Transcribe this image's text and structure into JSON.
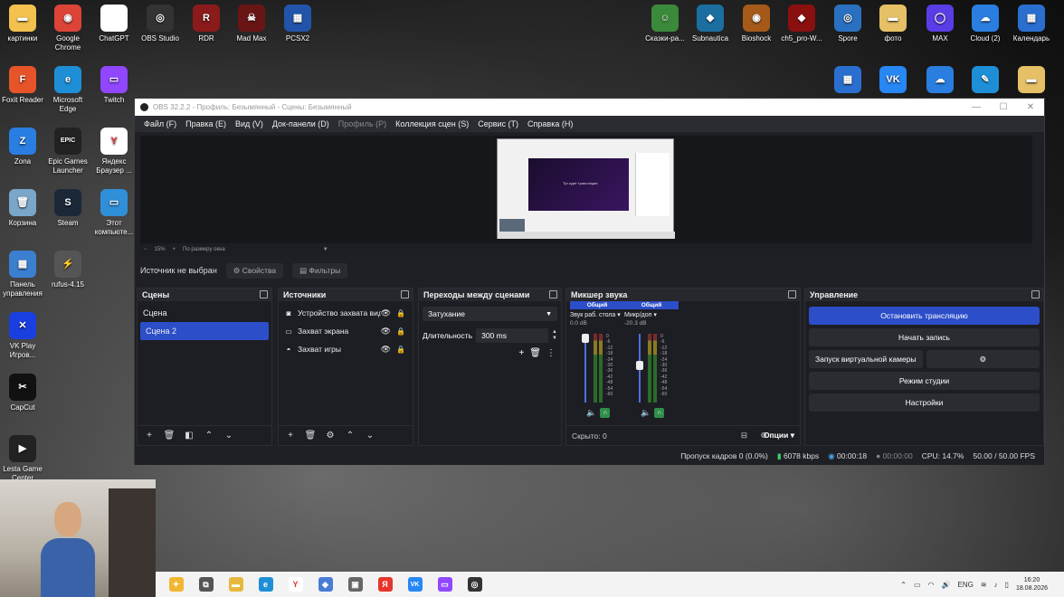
{
  "desktop": {
    "left_icons": [
      {
        "label": "картинки",
        "color": "#f2c14e",
        "glyph": "▬",
        "icon": "folder-icon"
      },
      {
        "label": "Foxit Reader",
        "color": "#e8542a",
        "glyph": "F",
        "icon": "foxit-icon"
      },
      {
        "label": "Zona",
        "color": "#2a7de1",
        "glyph": "Z",
        "icon": "zona-icon"
      },
      {
        "label": "Корзина",
        "color": "#7aa6c9",
        "glyph": "🗑",
        "icon": "recycle-bin-icon"
      },
      {
        "label": "Панель управления",
        "color": "#3b7fd0",
        "glyph": "▦",
        "icon": "control-panel-icon"
      },
      {
        "label": "VK Play Игров...",
        "color": "#1a3fe0",
        "glyph": "✕",
        "icon": "vk-play-icon"
      },
      {
        "label": "CapCut",
        "color": "#111111",
        "glyph": "✂",
        "icon": "capcut-icon"
      },
      {
        "label": "Lesta Game Center",
        "color": "#222222",
        "glyph": "▶",
        "icon": "lesta-icon"
      }
    ],
    "col2_icons": [
      {
        "label": "Google Chrome",
        "color": "#db4437",
        "glyph": "◉",
        "icon": "chrome-icon"
      },
      {
        "label": "Microsoft Edge",
        "color": "#1e8fd6",
        "glyph": "e",
        "icon": "edge-icon"
      },
      {
        "label": "Epic Games Launcher",
        "color": "#222222",
        "glyph": "EPIC",
        "icon": "epic-icon"
      },
      {
        "label": "Steam",
        "color": "#1b2838",
        "glyph": "S",
        "icon": "steam-icon"
      },
      {
        "label": "rufus-4.15",
        "color": "#555555",
        "glyph": "⚡",
        "icon": "rufus-icon"
      }
    ],
    "col3_icons": [
      {
        "label": "ChatGPT",
        "color": "#ffffff",
        "glyph": "",
        "icon": "file-icon"
      },
      {
        "label": "Twitch",
        "color": "#9146ff",
        "glyph": "▭",
        "icon": "twitch-icon"
      },
      {
        "label": "Яндекс Браузер ...",
        "color": "#ffffff",
        "glyph": "Y",
        "icon": "yandex-browser-icon"
      },
      {
        "label": "Этот компьюте...",
        "color": "#2f8fd8",
        "glyph": "▭",
        "icon": "computer-icon"
      }
    ],
    "top_row": [
      {
        "label": "OBS Studio",
        "color": "#333333",
        "glyph": "◎",
        "icon": "obs-icon"
      },
      {
        "label": "RDR",
        "color": "#8b1a1a",
        "glyph": "R",
        "icon": "rdr-icon"
      },
      {
        "label": "Mad Max",
        "color": "#6a1515",
        "glyph": "☠",
        "icon": "madmax-icon"
      },
      {
        "label": "PCSX2",
        "color": "#2255aa",
        "glyph": "▦",
        "icon": "pcsx2-icon"
      }
    ],
    "right_row": [
      {
        "label": "Сказки-ра...",
        "color": "#3b8a3b",
        "glyph": "☺",
        "icon": "game-icon"
      },
      {
        "label": "Subnautica",
        "color": "#1b6fa0",
        "glyph": "◆",
        "icon": "subnautica-icon"
      },
      {
        "label": "Bioshock",
        "color": "#a55a1a",
        "glyph": "◉",
        "icon": "bioshock-icon"
      },
      {
        "label": "ch5_pro-W...",
        "color": "#8a1010",
        "glyph": "◆",
        "icon": "game-icon"
      },
      {
        "label": "Spore",
        "color": "#2a70c0",
        "glyph": "◎",
        "icon": "spore-icon"
      },
      {
        "label": "фото",
        "color": "#e6c066",
        "glyph": "▬",
        "icon": "folder-icon"
      },
      {
        "label": "MAX",
        "color": "#5a3de6",
        "glyph": "◯",
        "icon": "max-icon"
      },
      {
        "label": "Cloud (2)",
        "color": "#2a7ee0",
        "glyph": "☁",
        "icon": "cloud-icon"
      },
      {
        "label": "Календарь",
        "color": "#2a6fd0",
        "glyph": "▦",
        "icon": "calendar-icon"
      }
    ],
    "right_row2": [
      {
        "label": "",
        "color": "#2a6fd0",
        "glyph": "▦",
        "icon": "calculator-icon"
      },
      {
        "label": "",
        "color": "#2787f5",
        "glyph": "VK",
        "icon": "vk-icon"
      },
      {
        "label": "",
        "color": "#2a7ee0",
        "glyph": "☁",
        "icon": "cloud-icon"
      },
      {
        "label": "",
        "color": "#1e8fd6",
        "glyph": "✎",
        "icon": "app-icon"
      },
      {
        "label": "",
        "color": "#e6c066",
        "glyph": "▬",
        "icon": "folder-icon"
      }
    ]
  },
  "obs": {
    "title": "OBS 32.2.2 - Профиль: Безымянный - Сцены: Безымянный",
    "menu": [
      {
        "label": "Файл (F)",
        "enabled": true
      },
      {
        "label": "Правка (E)",
        "enabled": true
      },
      {
        "label": "Вид (V)",
        "enabled": true
      },
      {
        "label": "Док-панели (D)",
        "enabled": true
      },
      {
        "label": "Профиль (P)",
        "enabled": false
      },
      {
        "label": "Коллекция сцен (S)",
        "enabled": true
      },
      {
        "label": "Сервис (T)",
        "enabled": true
      },
      {
        "label": "Справка (H)",
        "enabled": true
      }
    ],
    "preview": {
      "inner_text": "Тут идет трансляция",
      "zoom_minus": "−",
      "zoom_value": "15%",
      "zoom_plus": "+",
      "zoom_mode": "По размеру окна"
    },
    "source_bar": {
      "status": "Источник не выбран",
      "properties": "Свойства",
      "filters": "Фильтры"
    },
    "scenes": {
      "title": "Сцены",
      "items": [
        {
          "label": "Сцена",
          "selected": false
        },
        {
          "label": "Сцена 2",
          "selected": true
        }
      ]
    },
    "sources": {
      "title": "Источники",
      "items": [
        {
          "label": "Устройство захвата видео",
          "icon": "camera-icon",
          "glyph": "◙"
        },
        {
          "label": "Захват экрана",
          "icon": "monitor-icon",
          "glyph": "▭"
        },
        {
          "label": "Захват игры",
          "icon": "gamepad-icon",
          "glyph": "◓"
        }
      ]
    },
    "transitions": {
      "title": "Переходы между сценами",
      "selected": "Затухание",
      "duration_label": "Длительность",
      "duration_value": "300 ms"
    },
    "mixer": {
      "title": "Микшер звука",
      "channels": [
        {
          "tag": "Общий",
          "name": "Звук раб. стола",
          "db": "0.0 dB",
          "level": 1.0
        },
        {
          "tag": "Общий",
          "name": "Микр/доп",
          "db": "-20.3 dB",
          "level": 0.55
        }
      ],
      "scale": [
        "0",
        "-6",
        "-12",
        "-18",
        "-24",
        "-30",
        "-36",
        "-42",
        "-48",
        "-54",
        "-60"
      ],
      "hidden": "Скрыто: 0",
      "options": "Опции"
    },
    "controls": {
      "title": "Управление",
      "stop_stream": "Остановить трансляцию",
      "start_record": "Начать запись",
      "virtual_cam": "Запуск виртуальной камеры",
      "studio_mode": "Режим студии",
      "settings": "Настройки"
    },
    "status": {
      "dropped": "Пропуск кадров 0 (0.0%)",
      "bitrate": "6078 kbps",
      "stream_time": "00:00:18",
      "record_time": "00:00:00",
      "cpu": "CPU: 14.7%",
      "fps": "50.00 / 50.00 FPS"
    }
  },
  "taskbar": {
    "items": [
      {
        "icon": "copilot-icon",
        "color": "#f2b632",
        "glyph": "✦"
      },
      {
        "icon": "task-view-icon",
        "color": "#555555",
        "glyph": "⧉"
      },
      {
        "icon": "explorer-icon",
        "color": "#e6b93e",
        "glyph": "▬"
      },
      {
        "icon": "edge-icon",
        "color": "#1e8fd6",
        "glyph": "e"
      },
      {
        "icon": "yandex-browser-icon",
        "color": "#ffffff",
        "glyph": "Y"
      },
      {
        "icon": "store-icon",
        "color": "#4a7bd6",
        "glyph": "◆"
      },
      {
        "icon": "app-icon",
        "color": "#666666",
        "glyph": "▣"
      },
      {
        "icon": "yandex-icon",
        "color": "#e8342a",
        "glyph": "Я"
      },
      {
        "icon": "vk-icon",
        "color": "#2787f5",
        "glyph": "VK"
      },
      {
        "icon": "twitch-icon",
        "color": "#9146ff",
        "glyph": "▭"
      },
      {
        "icon": "obs-icon",
        "color": "#333333",
        "glyph": "◎"
      }
    ],
    "lang": "ENG",
    "time": "16:20",
    "date": "18.08.2026"
  }
}
